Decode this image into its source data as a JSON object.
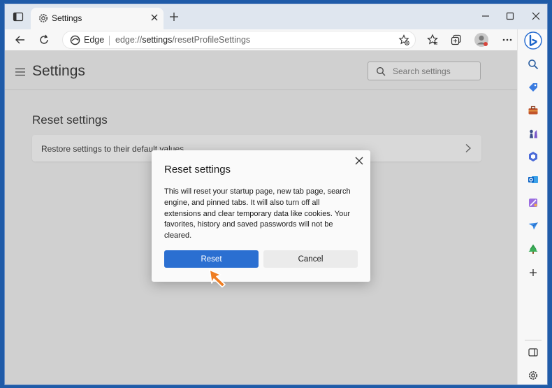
{
  "tab": {
    "title": "Settings"
  },
  "address_bar": {
    "edge_label": "Edge",
    "url_prefix": "edge://",
    "url_host": "settings",
    "url_path": "/resetProfileSettings"
  },
  "page": {
    "title": "Settings",
    "search_placeholder": "Search settings",
    "section_title": "Reset settings",
    "restore_label": "Restore settings to their default values"
  },
  "dialog": {
    "title": "Reset settings",
    "body": "This will reset your startup page, new tab page, search engine, and pinned tabs. It will also turn off all extensions and clear temporary data like cookies. Your favorites, history and saved passwords will not be cleared.",
    "reset_label": "Reset",
    "cancel_label": "Cancel"
  },
  "sidebar_icons": [
    "search-icon",
    "tag-icon",
    "toolbox-icon",
    "chess-icon",
    "office-icon",
    "outlook-icon",
    "designer-icon",
    "drop-icon",
    "tree-icon",
    "add-icon"
  ],
  "colors": {
    "accent": "#2b6fd1",
    "cursor": "#ef7d22"
  }
}
